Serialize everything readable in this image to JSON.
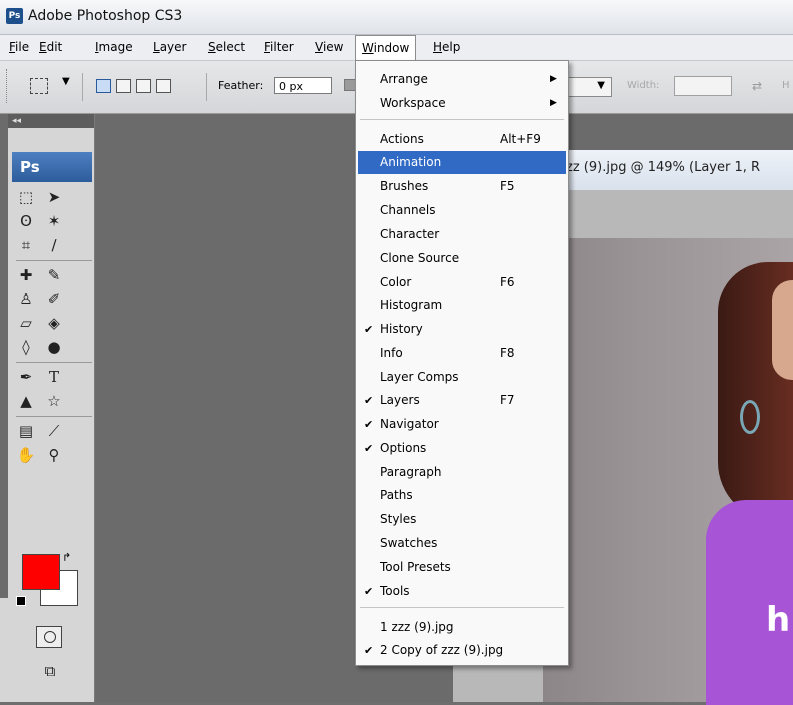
{
  "app": {
    "title": "Adobe Photoshop CS3",
    "icon_text": "Ps"
  },
  "menubar": [
    "File",
    "Edit",
    "Image",
    "Layer",
    "Select",
    "Filter",
    "View",
    "Window",
    "Help"
  ],
  "options": {
    "feather_label": "Feather:",
    "feather_value": "0 px",
    "width_label": "Width:",
    "height_label": "H"
  },
  "tools": {
    "header": "◂◂",
    "logo": "Ps"
  },
  "document": {
    "title": "zz (9).jpg @ 149% (Layer 1, R"
  },
  "photo": {
    "shirt_text": "hi"
  },
  "window_menu": {
    "items": [
      {
        "label": "Arrange",
        "submenu": true
      },
      {
        "label": "Workspace",
        "submenu": true
      },
      {
        "label": "Actions",
        "shortcut": "Alt+F9"
      },
      {
        "label": "Animation",
        "highlighted": true
      },
      {
        "label": "Brushes",
        "shortcut": "F5"
      },
      {
        "label": "Channels"
      },
      {
        "label": "Character"
      },
      {
        "label": "Clone Source"
      },
      {
        "label": "Color",
        "shortcut": "F6"
      },
      {
        "label": "Histogram"
      },
      {
        "label": "History",
        "checked": true
      },
      {
        "label": "Info",
        "shortcut": "F8"
      },
      {
        "label": "Layer Comps"
      },
      {
        "label": "Layers",
        "shortcut": "F7",
        "checked": true
      },
      {
        "label": "Navigator",
        "checked": true
      },
      {
        "label": "Options",
        "checked": true
      },
      {
        "label": "Paragraph"
      },
      {
        "label": "Paths"
      },
      {
        "label": "Styles"
      },
      {
        "label": "Swatches"
      },
      {
        "label": "Tool Presets"
      },
      {
        "label": "Tools",
        "checked": true
      },
      {
        "label": "1 zzz (9).jpg"
      },
      {
        "label": "2 Copy of zzz (9).jpg",
        "checked": true
      }
    ]
  },
  "colors": {
    "foreground": "#ff0000",
    "background": "#ffffff",
    "highlight": "#316ac5"
  }
}
